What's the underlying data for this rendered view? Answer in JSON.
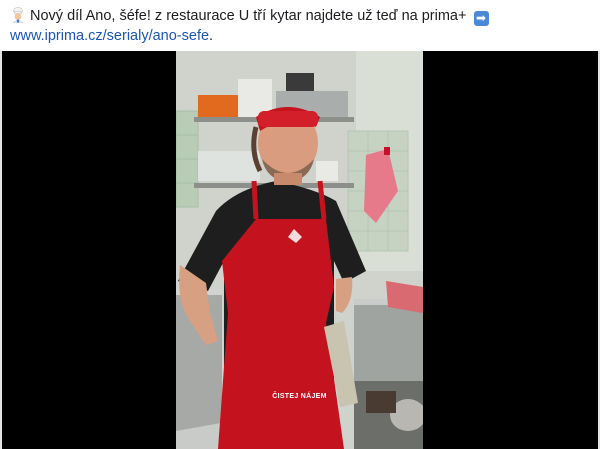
{
  "post": {
    "text": "Nový díl Ano, šéfe! z restaurace U tří kytar najdete už teď na prima+",
    "chef_emoji": "chef-emoji",
    "arrow_emoji": "➡",
    "link_text": "www.iprima.cz/serialy/ano-sefe",
    "link_suffix": "."
  },
  "video": {
    "caption": "ČISTEJ NÁJEM"
  },
  "colors": {
    "link": "#1a55b5",
    "text": "#1c1e21",
    "apron": "#c4131f",
    "background": "#000000"
  }
}
